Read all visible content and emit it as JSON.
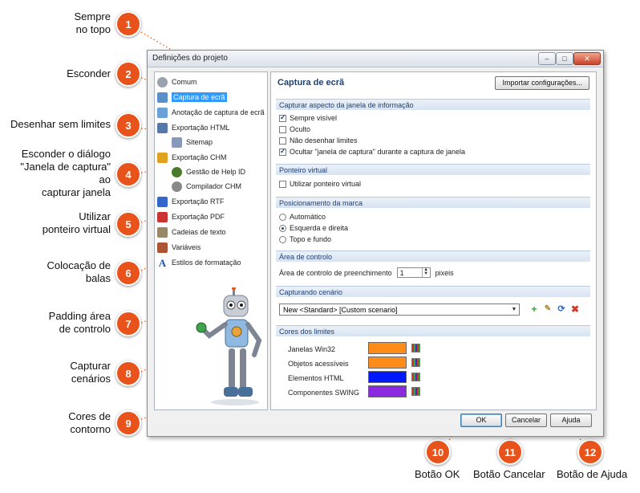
{
  "callouts": [
    {
      "num": "1",
      "text": "Sempre\nno topo"
    },
    {
      "num": "2",
      "text": "Esconder"
    },
    {
      "num": "3",
      "text": "Desenhar sem limites"
    },
    {
      "num": "4",
      "text": "Esconder o diálogo\n\"Janela de captura\"\nao\ncapturar janela"
    },
    {
      "num": "5",
      "text": "Utilizar\nponteiro virtual"
    },
    {
      "num": "6",
      "text": "Colocação de\nbalas"
    },
    {
      "num": "7",
      "text": "Padding área\nde controlo"
    },
    {
      "num": "8",
      "text": "Capturar\ncenários"
    },
    {
      "num": "9",
      "text": "Cores de\ncontorno"
    },
    {
      "num": "10",
      "text": "Botão OK"
    },
    {
      "num": "11",
      "text": "Botão Cancelar"
    },
    {
      "num": "12",
      "text": "Botão de Ajuda"
    }
  ],
  "dialog": {
    "title": "Definições do projeto",
    "minimize": "–",
    "maximize": "□",
    "close": "✕",
    "tree": [
      {
        "label": "Comum",
        "icon": "gear-icon",
        "color": "#9aa3ad"
      },
      {
        "label": "Captura de ecrã",
        "icon": "screen-capture-icon",
        "color": "#5b8fc9",
        "selected": true
      },
      {
        "label": "Anotação de captura de ecrã",
        "icon": "annotation-icon",
        "color": "#6aa0d8"
      },
      {
        "label": "Exportação HTML",
        "icon": "html-export-icon",
        "color": "#5577aa"
      },
      {
        "label": "Sitemap",
        "icon": "sitemap-icon",
        "color": "#8899bb"
      },
      {
        "label": "Exportação CHM",
        "icon": "chm-export-icon",
        "color": "#e0a020"
      },
      {
        "label": "Gestão de Help ID",
        "icon": "help-id-icon",
        "color": "#4a7a2a"
      },
      {
        "label": "Compilador CHM",
        "icon": "compiler-icon",
        "color": "#888888"
      },
      {
        "label": "Exportação RTF",
        "icon": "rtf-export-icon",
        "color": "#3366cc"
      },
      {
        "label": "Exportação PDF",
        "icon": "pdf-export-icon",
        "color": "#cc3333"
      },
      {
        "label": "Cadeias de texto",
        "icon": "text-strings-icon",
        "color": "#998866"
      },
      {
        "label": "Variáveis",
        "icon": "variables-icon",
        "color": "#aa5533"
      },
      {
        "label": "Estilos de formatação",
        "icon": "formatting-styles-icon",
        "color": "#2255aa"
      }
    ],
    "panel_title": "Captura de ecrã",
    "import_button": "Importar configurações...",
    "sections": {
      "info_window": "Capturar aspecto da janela de informação",
      "virtual_pointer": "Ponteiro virtual",
      "marker_position": "Posicionamento da marca",
      "control_area": "Área de controlo",
      "scenario": "Capturando cenário",
      "border_colors": "Cores dos limites"
    },
    "options": {
      "always_visible": "Sempre visível",
      "hidden": "Oculto",
      "no_borders": "Não desenhar limites",
      "hide_capture_window": "Ocultar \"janela de captura\" durante a captura de janela",
      "use_virtual_pointer": "Utilizar ponteiro virtual",
      "automatic": "Automático",
      "left_right": "Esquerda e direita",
      "top_bottom": "Topo e fundo",
      "padding_label": "Área de controlo de preenchimento",
      "padding_value": "1",
      "padding_unit": "pixeis",
      "scenario_value": "New <Standard> [Custom scenario]"
    },
    "colors": [
      {
        "label": "Janelas Win32",
        "color": "#ff8c1a"
      },
      {
        "label": "Objetos acessíveis",
        "color": "#ff8c1a"
      },
      {
        "label": "Elementos HTML",
        "color": "#0019ff"
      },
      {
        "label": "Componentes SWING",
        "color": "#8a2be2"
      }
    ],
    "buttons": {
      "ok": "OK",
      "cancel": "Cancelar",
      "help": "Ajuda"
    }
  }
}
